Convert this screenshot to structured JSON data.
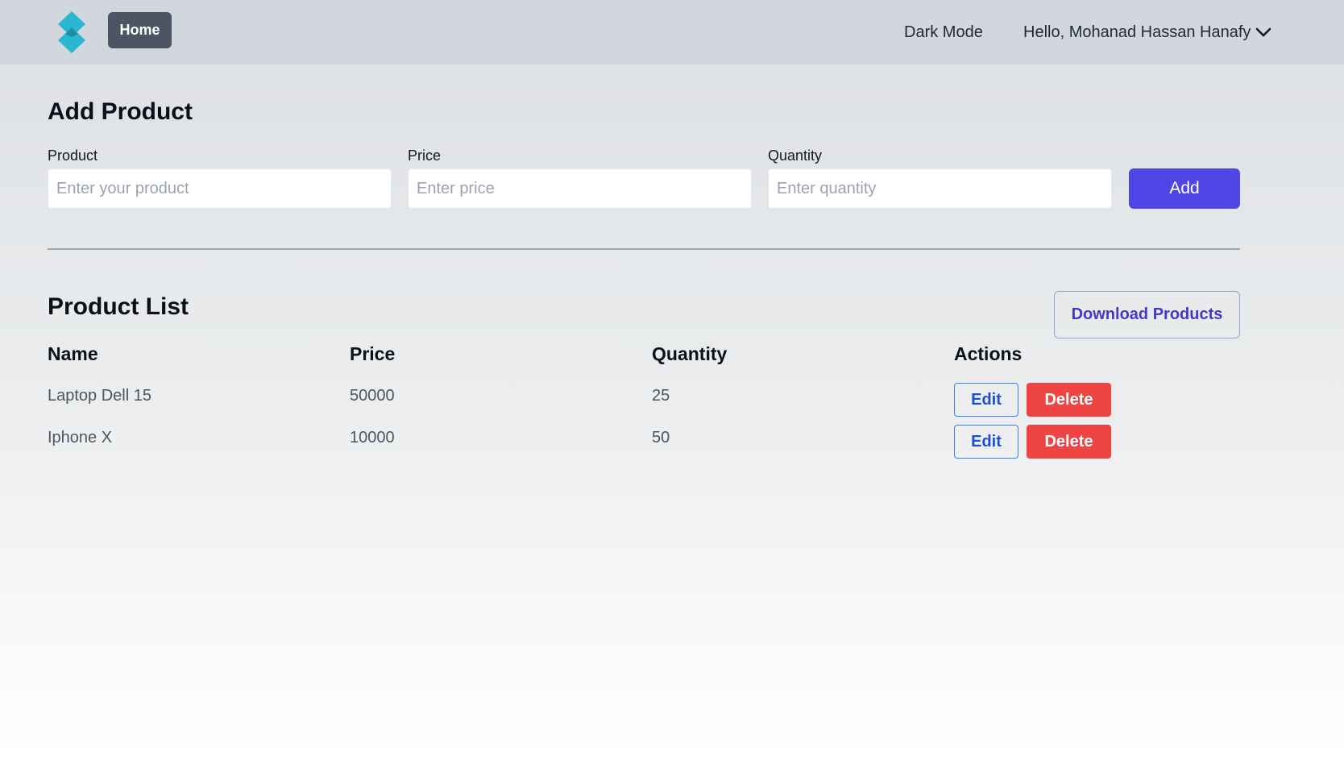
{
  "navbar": {
    "logo_icon": "brand-logo-icon",
    "home_label": "Home",
    "dark_mode_label": "Dark Mode",
    "user_greeting": "Hello, Mohanad Hassan Hanafy",
    "user_menu_icon": "chevron-down-icon"
  },
  "add_product": {
    "title": "Add Product",
    "product": {
      "label": "Product",
      "placeholder": "Enter your product",
      "value": ""
    },
    "price": {
      "label": "Price",
      "placeholder": "Enter price",
      "value": ""
    },
    "quantity": {
      "label": "Quantity",
      "placeholder": "Enter quantity",
      "value": ""
    },
    "add_label": "Add"
  },
  "product_list": {
    "title": "Product List",
    "download_label": "Download Products",
    "columns": [
      "Name",
      "Price",
      "Quantity",
      "Actions"
    ],
    "rows": [
      {
        "name": "Laptop Dell 15",
        "price": "50000",
        "quantity": "25",
        "edit_label": "Edit",
        "delete_label": "Delete"
      },
      {
        "name": "Iphone X",
        "price": "10000",
        "quantity": "50",
        "edit_label": "Edit",
        "delete_label": "Delete"
      }
    ]
  },
  "colors": {
    "navbar_bg": "#d2d6dd",
    "home_button": "#4b5563",
    "primary": "#4f46e5",
    "danger": "#ef4444",
    "edit_accent": "#1d4ed8",
    "logo": "#2bb6d1"
  }
}
